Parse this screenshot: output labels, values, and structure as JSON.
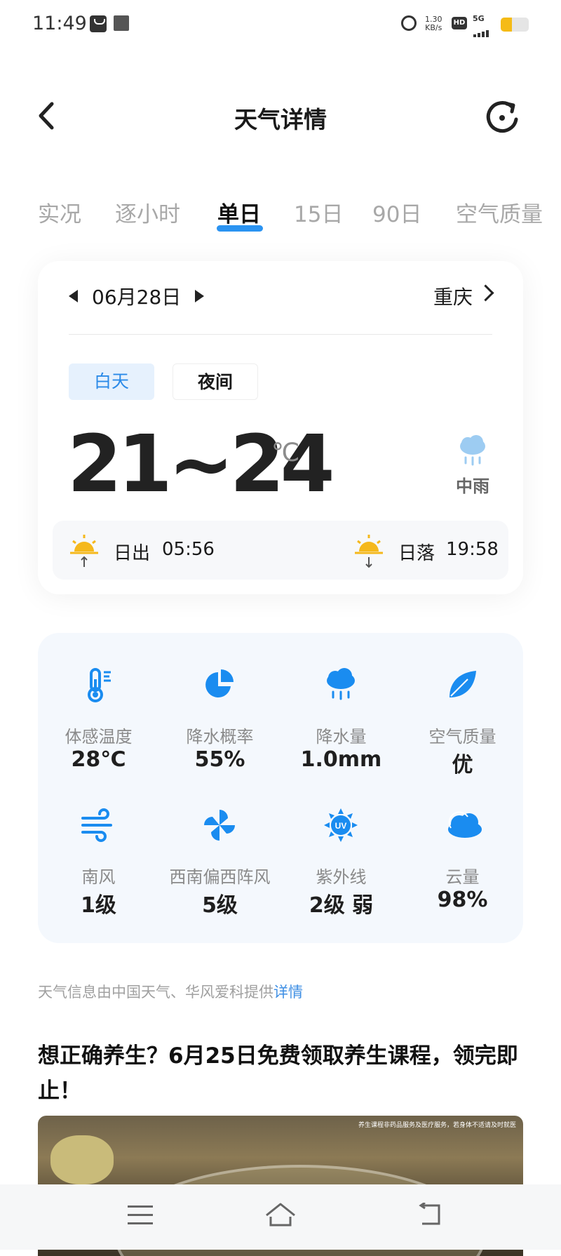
{
  "status_bar": {
    "time": "11:49",
    "net_speed_value": "1.30",
    "net_speed_unit": "KB/s",
    "hd": "HD",
    "network": "5G"
  },
  "header": {
    "title": "天气详情"
  },
  "tabs": [
    {
      "label": "实况"
    },
    {
      "label": "逐小时"
    },
    {
      "label": "单日"
    },
    {
      "label": "15日"
    },
    {
      "label": "90日"
    },
    {
      "label": "空气质量"
    }
  ],
  "day_card": {
    "date": "06月28日",
    "city": "重庆",
    "toggle_day": "白天",
    "toggle_night": "夜间",
    "temp_range": "21~24",
    "temp_unit": "℃",
    "weather": "中雨",
    "sunrise_label": "日出",
    "sunrise_time": "05:56",
    "sunset_label": "日落",
    "sunset_time": "19:58"
  },
  "details": [
    {
      "label": "体感温度",
      "value": "28℃",
      "icon": "thermometer-icon"
    },
    {
      "label": "降水概率",
      "value": "55%",
      "icon": "pie-chart-icon"
    },
    {
      "label": "降水量",
      "value": "1.0mm",
      "icon": "rain-cloud-icon"
    },
    {
      "label": "空气质量",
      "value": "优",
      "icon": "leaf-icon"
    },
    {
      "label": "南风",
      "value": "1级",
      "icon": "wind-icon"
    },
    {
      "label": "西南偏西阵风",
      "value": "5级",
      "icon": "pinwheel-icon"
    },
    {
      "label": "紫外线",
      "value": "2级 弱",
      "icon": "uv-icon"
    },
    {
      "label": "云量",
      "value": "98%",
      "icon": "cloud-icon"
    }
  ],
  "provider": {
    "text": "天气信息由中国天气、华风爱科提供",
    "link": "详情"
  },
  "article": {
    "title": "想正确养生？6月25日免费领取养生课程，领完即止！",
    "image_caption": "养生课程非药品服务及医疗服务，若身体不适请及时就医"
  },
  "colors": {
    "accent": "#2b93f1",
    "icon_blue": "#1a8cf0",
    "sun_yellow": "#f5b81c"
  }
}
